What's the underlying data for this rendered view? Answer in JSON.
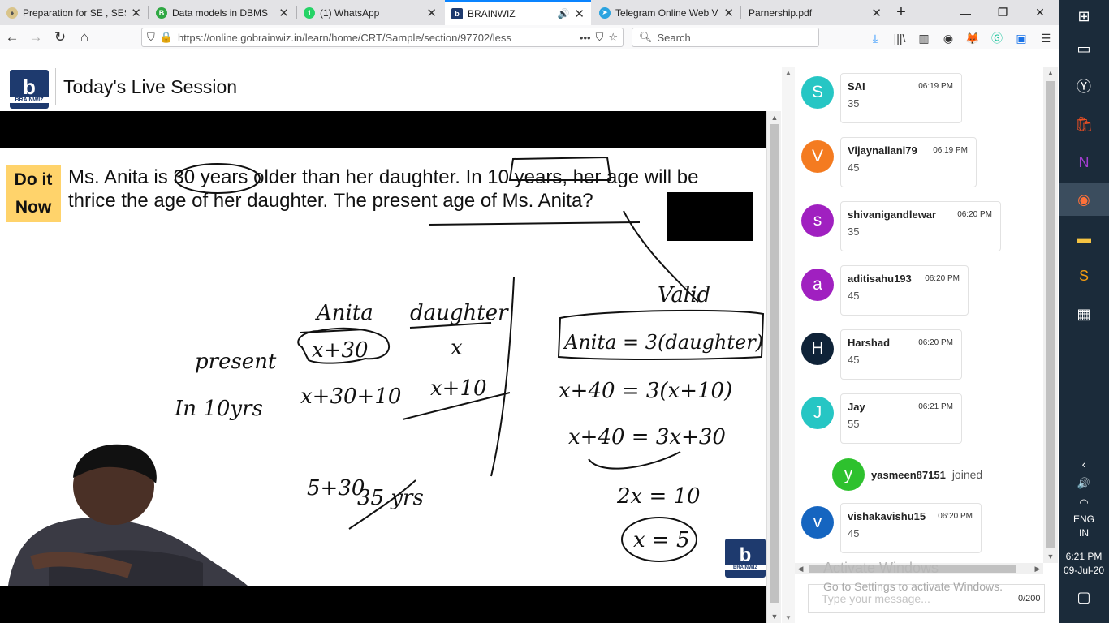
{
  "browser": {
    "tabs": [
      {
        "label": "Preparation for SE , SES",
        "icon": "lamp-icon",
        "color": "#888888",
        "active": false
      },
      {
        "label": "Data models in DBMS",
        "icon": "b-icon",
        "color": "#2fa843",
        "active": false
      },
      {
        "label": "(1) WhatsApp",
        "icon": "whatsapp-icon",
        "color": "#25d366",
        "active": false
      },
      {
        "label": "BRAINWIZ",
        "icon": "brainwiz-icon",
        "color": "#1e3a6e",
        "active": true
      },
      {
        "label": "Telegram Online Web V",
        "icon": "telegram-icon",
        "color": "#2aa3e0",
        "active": false
      },
      {
        "label": "Parnership.pdf",
        "icon": "pdf-icon",
        "color": "#cccccc",
        "active": false
      }
    ],
    "new_tab": "+",
    "url": "https://online.gobrainwiz.in/learn/home/CRT/Sample/section/97702/less",
    "search_placeholder": "Search"
  },
  "page": {
    "title": "Today's Live Session",
    "logo_text": "BRAINWIZ",
    "logo_letter": "b"
  },
  "board": {
    "badge_line1": "Do it",
    "badge_line2": "Now",
    "question_line1": "Ms. Anita is 30 years older than her daughter. In 10 years, her age will be",
    "question_line2": "thrice the age of her daughter. The present age of Ms. Anita?",
    "hw": {
      "col_anita": "Anita",
      "col_daughter": "daughter",
      "row_present": "present",
      "row_10yrs": "In 10yrs",
      "anita_present": "x+30",
      "daughter_present": "x",
      "anita_future": "x+30+10",
      "daughter_future": "x+10",
      "calc1": "5+30",
      "calc2": "35 yrs",
      "valid": "Valid",
      "eq1": "Anita = 3(daughter)",
      "eq2": "x+40 = 3(x+10)",
      "eq3": "x+40 = 3x+30",
      "eq4": "2x = 10",
      "eq5": "x = 5"
    }
  },
  "chat": {
    "messages": [
      {
        "initial": "S",
        "name": "SAI",
        "time": "06:19 PM",
        "text": "35",
        "color": "#26c6c4"
      },
      {
        "initial": "V",
        "name": "Vijaynallani79",
        "time": "06:19 PM",
        "text": "45",
        "color": "#f47b20"
      },
      {
        "initial": "s",
        "name": "shivanigandlewar",
        "time": "06:20 PM",
        "text": "35",
        "color": "#a020c0"
      },
      {
        "initial": "a",
        "name": "aditisahu193",
        "time": "06:20 PM",
        "text": "45",
        "color": "#a020c0"
      },
      {
        "initial": "H",
        "name": "Harshad",
        "time": "06:20 PM",
        "text": "45",
        "color": "#0f2338"
      },
      {
        "initial": "J",
        "name": "Jay",
        "time": "06:21 PM",
        "text": "55",
        "color": "#26c6c4"
      },
      {
        "initial": "v",
        "name": "vishakavishu15",
        "time": "06:20 PM",
        "text": "45",
        "color": "#1565c0"
      }
    ],
    "join": {
      "initial": "y",
      "name": "yasmeen87151",
      "action": "joined",
      "color": "#2ec12e"
    },
    "watermark_title": "Activate Windows",
    "watermark_sub": "Go to Settings to activate Windows.",
    "input_placeholder": "Type your message...",
    "char_count": "0/200"
  },
  "taskbar": {
    "lang1": "ENG",
    "lang2": "IN",
    "time": "6:21 PM",
    "date": "09-Jul-20"
  }
}
